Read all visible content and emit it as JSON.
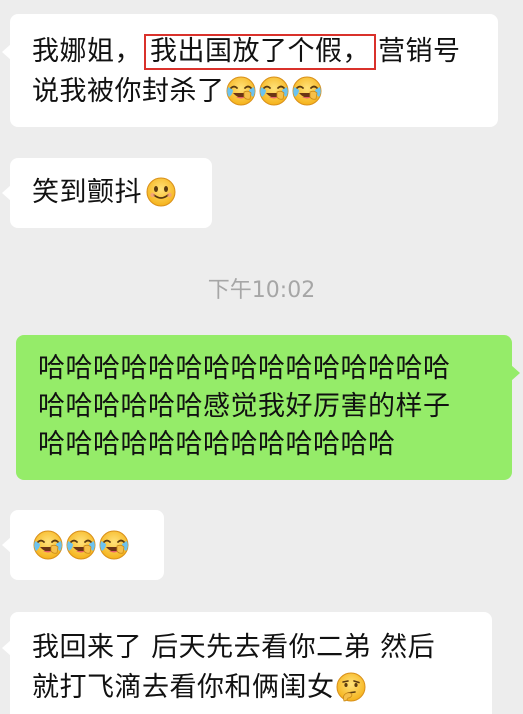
{
  "messages": [
    {
      "id": "m1",
      "direction": "incoming",
      "line1_before": "我娜姐，",
      "line1_highlight": "我出国放了个假，",
      "line1_after": "营销号",
      "line2_text": "说我被你封杀了",
      "emojis": [
        "laugh-cry-emoji",
        "laugh-cry-emoji",
        "laugh-cry-emoji"
      ]
    },
    {
      "id": "m2",
      "direction": "incoming",
      "text": "笑到颤抖",
      "emojis": [
        "smile-emoji"
      ]
    },
    {
      "id": "m3",
      "direction": "outgoing",
      "lines": [
        "哈哈哈哈哈哈哈哈哈哈哈哈哈哈哈",
        "哈哈哈哈哈哈感觉我好厉害的样子",
        "哈哈哈哈哈哈哈哈哈哈哈哈哈"
      ]
    },
    {
      "id": "m4",
      "direction": "incoming",
      "emojis": [
        "laugh-cry-emoji",
        "laugh-cry-emoji",
        "laugh-cry-emoji"
      ]
    },
    {
      "id": "m5",
      "direction": "incoming",
      "lines": [
        "我回来了 后天先去看你二弟 然后",
        "就打飞滴去看你和俩闺女"
      ],
      "emojis": [
        "thinking-emoji"
      ]
    }
  ],
  "timestamp": "下午10:02",
  "colors": {
    "background": "#ededed",
    "incoming_bubble": "#ffffff",
    "outgoing_bubble": "#95ec69",
    "highlight_box": "#d9312b",
    "timestamp_text": "#a6a6a6"
  }
}
